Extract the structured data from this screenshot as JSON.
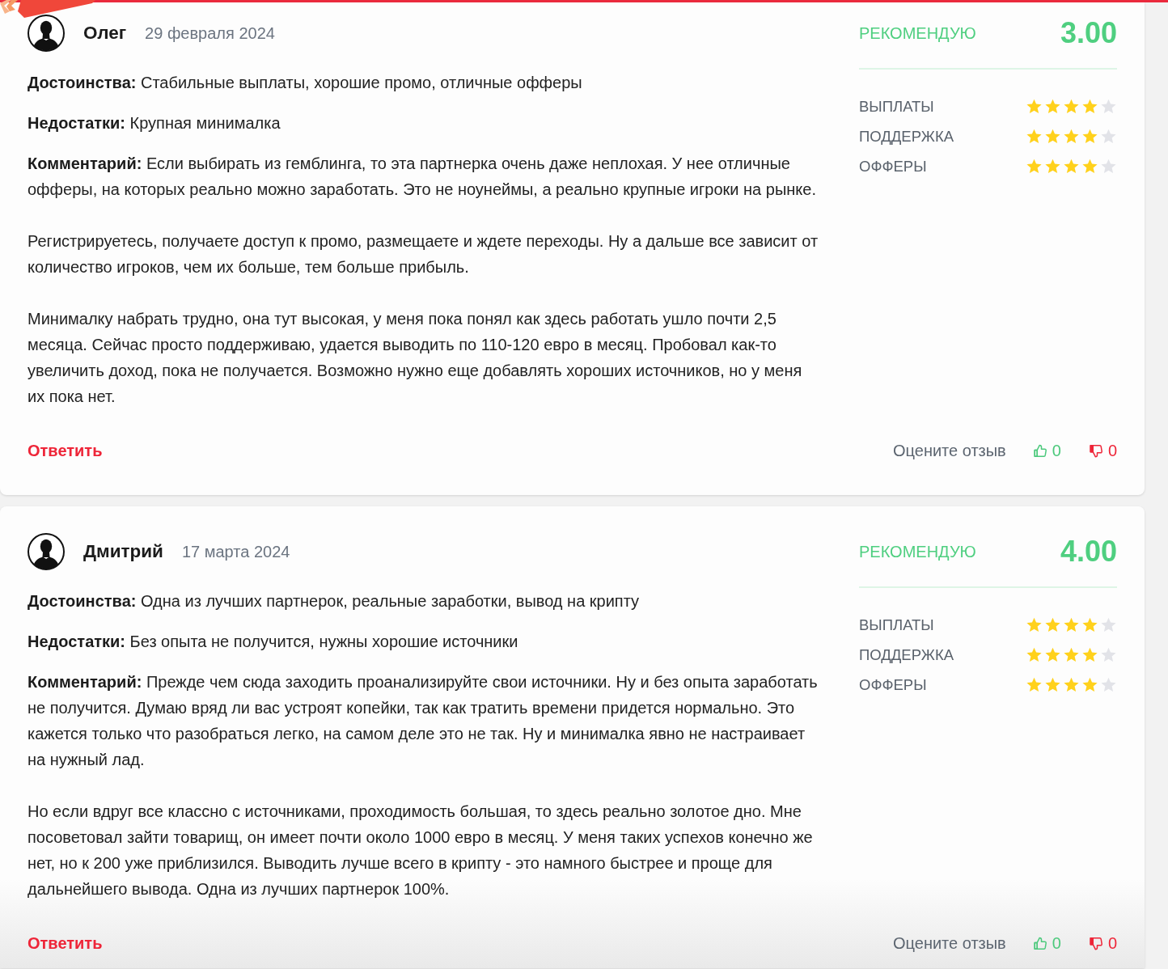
{
  "reviews": [
    {
      "author": "Олег",
      "date": "29 февраля 2024",
      "pros": "**Достоинства:** Стабильные выплаты, хорошие промо, отличные офферы",
      "cons": "**Недостатки:** Крупная минималка",
      "comment": [
        "**Комментарий:** Если выбирать из гемблинга, то эта партнерка очень даже неплохая. У нее отличные офферы, на которых реально можно заработать. Это не ноунеймы, а реально крупные игроки на рынке.",
        "Регистрируетесь, получаете доступ к промо, размещаете и ждете переходы. Ну а дальше все зависит от количество игроков, чем их больше, тем больше прибыль.",
        "Минималку набрать трудно, она тут высокая, у меня пока понял как здесь работать ушло почти 2,5 месяца. Сейчас просто поддерживаю, удается выводить по 110-120 евро в месяц. Пробовал как-то увеличить доход, пока не получается. Возможно нужно еще добавлять хороших источников, но у меня их пока нет."
      ],
      "verdict": "РЕКОМЕНДУЮ",
      "score": "3.00",
      "criteria": [
        {
          "label": "ВЫПЛАТЫ",
          "stars": 4
        },
        {
          "label": "ПОДДЕРЖКА",
          "stars": 4
        },
        {
          "label": "ОФФЕРЫ",
          "stars": 4
        }
      ],
      "reply": "Ответить",
      "rate_prompt": "Оцените отзыв",
      "likes": "0",
      "dislikes": "0"
    },
    {
      "author": "Дмитрий",
      "date": "17 марта 2024",
      "pros": "**Достоинства:** Одна из лучших партнерок, реальные заработки, вывод на крипту",
      "cons": "**Недостатки:** Без опыта не получится, нужны хорошие источники",
      "comment": [
        "**Комментарий:** Прежде чем сюда заходить проанализируйте свои источники. Ну и без опыта заработать не получится. Думаю вряд ли вас устроят копейки, так как тратить времени придется нормально. Это кажется только что разобраться легко, на самом деле это не так. Ну и минималка явно не настраивает на нужный лад.",
        "Но если вдруг все классно с источниками, проходимость большая, то здесь реально золотое дно. Мне посоветовал зайти товарищ, он имеет почти около 1000 евро в месяц. У меня таких успехов конечно же нет, но к 200 уже приблизился. Выводить лучше всего в крипту - это намного быстрее и проще для дальнейшего вывода. Одна из лучших партнерок 100%."
      ],
      "verdict": "РЕКОМЕНДУЮ",
      "score": "4.00",
      "criteria": [
        {
          "label": "ВЫПЛАТЫ",
          "stars": 4
        },
        {
          "label": "ПОДДЕРЖКА",
          "stars": 4
        },
        {
          "label": "ОФФЕРЫ",
          "stars": 4
        }
      ],
      "reply": "Ответить",
      "rate_prompt": "Оцените отзыв",
      "likes": "0",
      "dislikes": "0"
    }
  ]
}
